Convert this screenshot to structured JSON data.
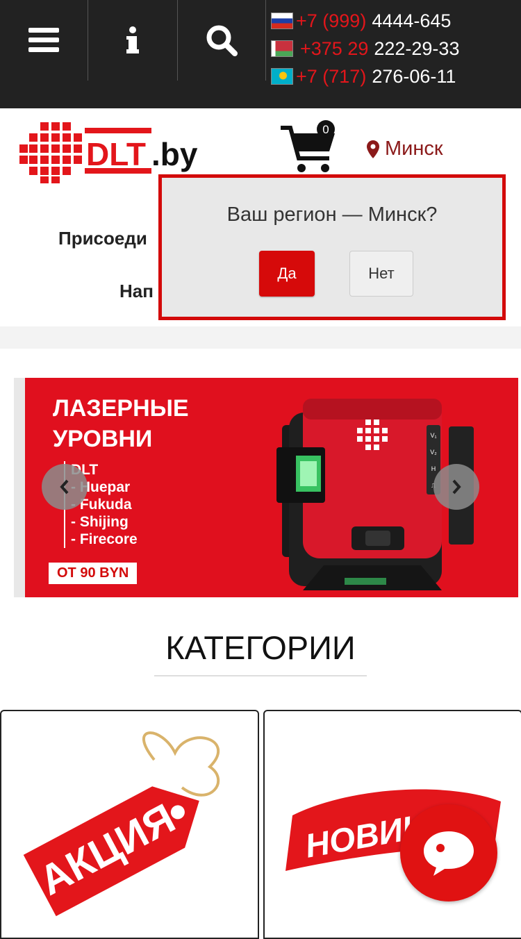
{
  "topbar": {
    "phones": [
      {
        "flag": "russia-flag",
        "code": "+7 (999)",
        "number": "4444-645"
      },
      {
        "flag": "belarus-flag",
        "code": "+375 29",
        "number": "222-29-33"
      },
      {
        "flag": "kazakhstan-flag",
        "code": "+7 (717)",
        "number": "276-06-11"
      }
    ]
  },
  "header": {
    "logo_text": "DLT.by",
    "cart_count": "0",
    "city": "Минск",
    "menu_line1": "Присоеди",
    "menu_line2": "Нап"
  },
  "region_popup": {
    "question": "Ваш регион — Минск?",
    "yes_label": "Да",
    "no_label": "Нет"
  },
  "banner": {
    "title_line1": "ЛАЗЕРНЫЕ",
    "title_line2": "УРОВНИ",
    "brands": [
      "DLT",
      "- Huepar",
      "- Fukuda",
      "- Shijing",
      "- Firecore"
    ],
    "price": "ОТ 90 BYN",
    "device_labels": [
      "V₁",
      "V₂",
      "H",
      "⎍"
    ]
  },
  "categories": {
    "title": "КАТЕГОРИИ",
    "items": [
      {
        "label": "АКЦИЯ"
      },
      {
        "label": "НОВИНКА"
      }
    ]
  },
  "colors": {
    "accent": "#e3161b",
    "dark": "#222222",
    "city": "#8b1a1a"
  }
}
